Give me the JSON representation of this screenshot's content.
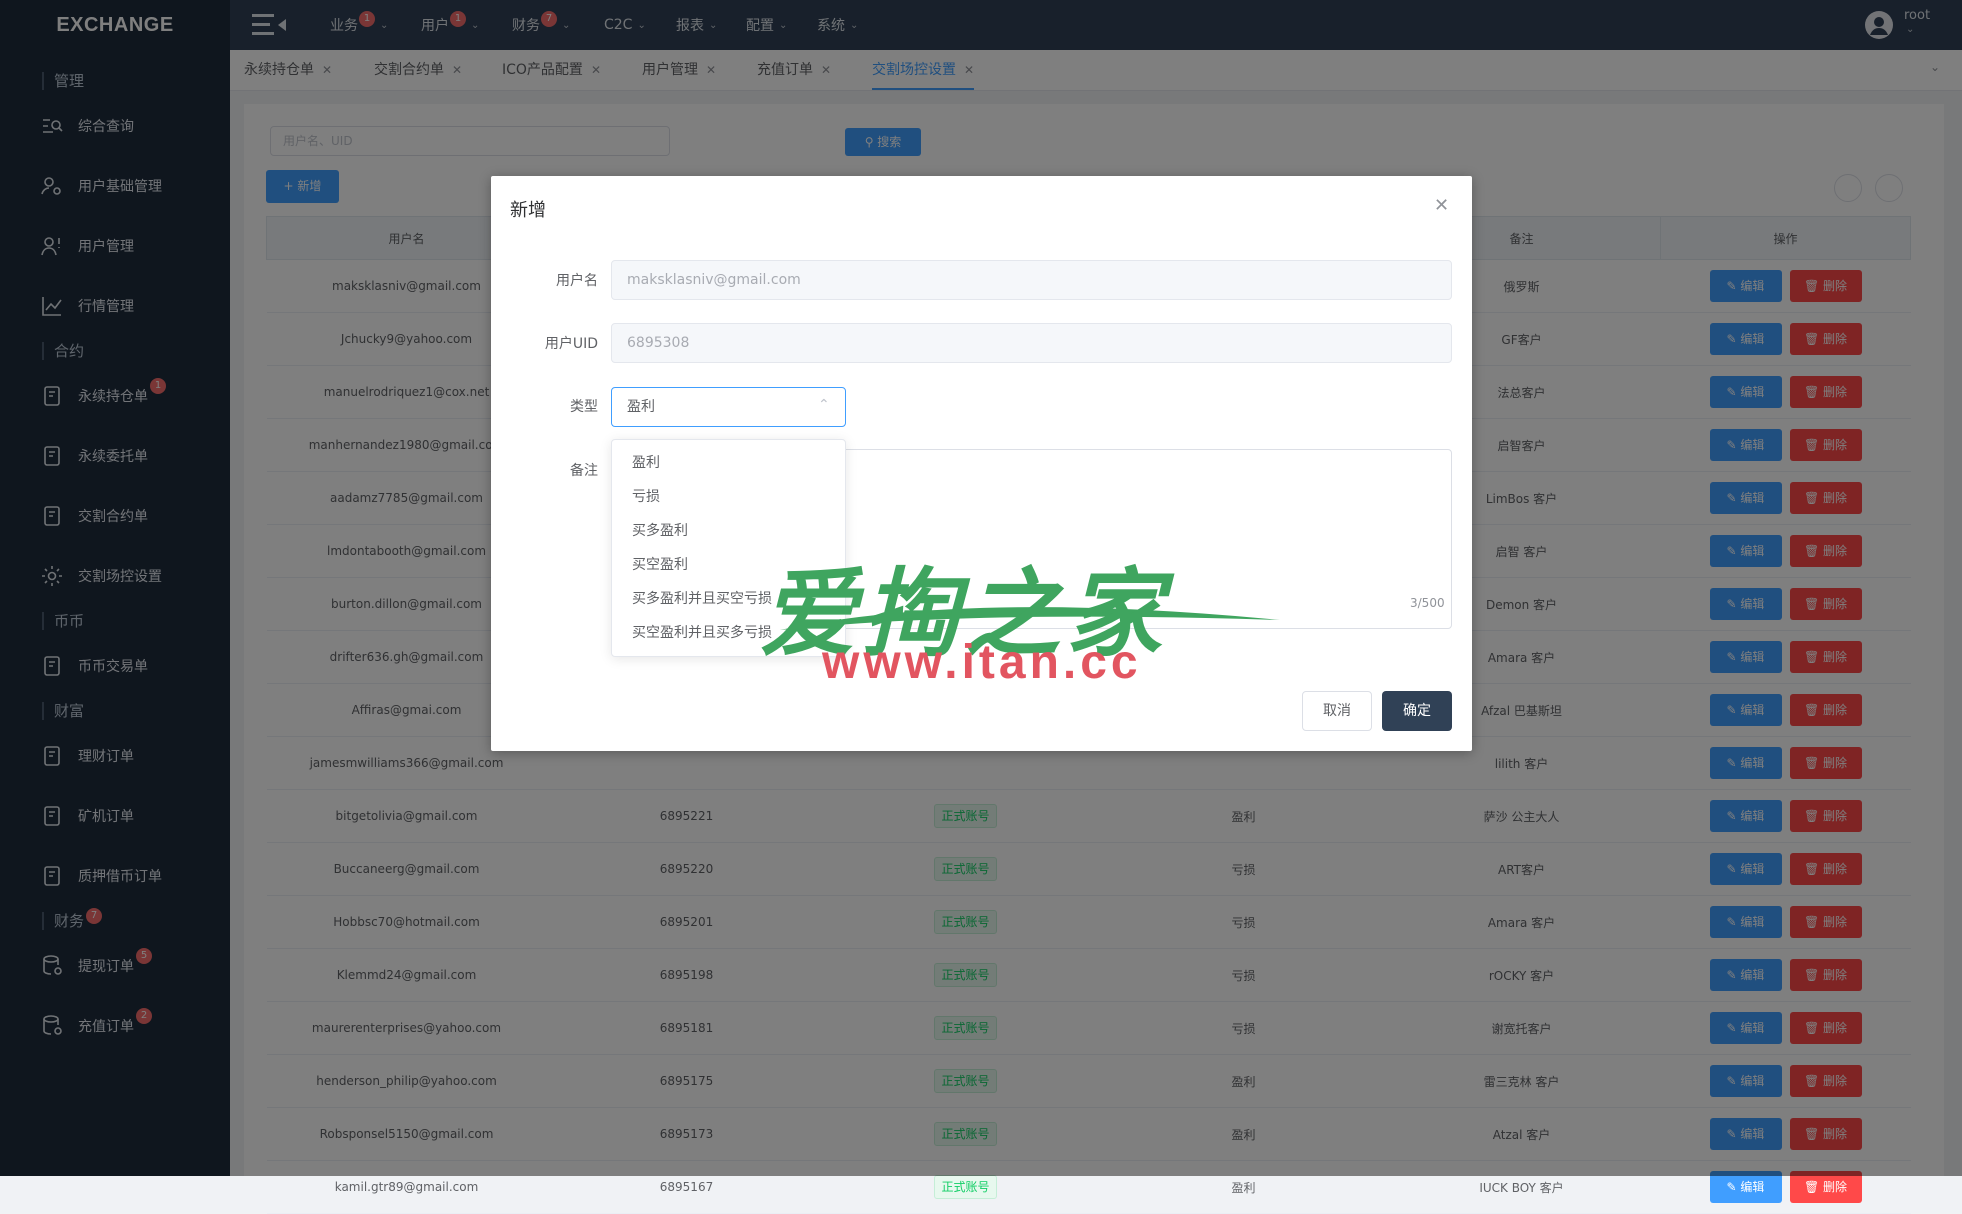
{
  "app": {
    "logo": "EXCHANGE"
  },
  "sidebar": {
    "sections": [
      "管理",
      "合约",
      "币币",
      "财富",
      "财务"
    ],
    "finance_badge": "7",
    "items": [
      {
        "label": "综合查询",
        "icon": "search-list-icon"
      },
      {
        "label": "用户基础管理",
        "icon": "user-gear-icon"
      },
      {
        "label": "用户管理",
        "icon": "user-alert-icon"
      },
      {
        "label": "行情管理",
        "icon": "chart-line-icon"
      },
      {
        "label": "永续持仓单",
        "icon": "document-icon",
        "badge": "1"
      },
      {
        "label": "永续委托单",
        "icon": "document-icon"
      },
      {
        "label": "交割合约单",
        "icon": "document-icon"
      },
      {
        "label": "交割场控设置",
        "icon": "gear-icon"
      },
      {
        "label": "币币交易单",
        "icon": "document-icon"
      },
      {
        "label": "理财订单",
        "icon": "document-icon"
      },
      {
        "label": "矿机订单",
        "icon": "document-icon"
      },
      {
        "label": "质押借币订单",
        "icon": "document-icon"
      },
      {
        "label": "提现订单",
        "icon": "database-icon",
        "badge": "5"
      },
      {
        "label": "充值订单",
        "icon": "database-icon",
        "badge": "2"
      }
    ]
  },
  "topnav": {
    "items": [
      {
        "label": "业务",
        "badge": "1"
      },
      {
        "label": "用户",
        "badge": "1"
      },
      {
        "label": "财务",
        "badge": "7"
      },
      {
        "label": "C2C"
      },
      {
        "label": "报表"
      },
      {
        "label": "配置"
      },
      {
        "label": "系统"
      }
    ],
    "user": "root"
  },
  "tabs": [
    {
      "label": "永续持仓单",
      "active": false
    },
    {
      "label": "交割合约单",
      "active": false
    },
    {
      "label": "ICO产品配置",
      "active": false
    },
    {
      "label": "用户管理",
      "active": false
    },
    {
      "label": "充值订单",
      "active": false
    },
    {
      "label": "交割场控设置",
      "active": true
    }
  ],
  "toolbar": {
    "search_placeholder": "用户名、UID",
    "search_button": "搜索",
    "new_button": "新增"
  },
  "table": {
    "headers": [
      "用户名",
      "",
      "",
      "",
      "备注",
      "操作"
    ],
    "edit_label": "编辑",
    "delete_label": "删除",
    "rows": [
      {
        "user": "maksklasniv@gmail.com",
        "uid": "",
        "status": "",
        "type": "",
        "remark": "俄罗斯"
      },
      {
        "user": "Jchucky9@yahoo.com",
        "uid": "",
        "status": "",
        "type": "",
        "remark": "GF客户"
      },
      {
        "user": "manuelrodriquez1@cox.net",
        "uid": "",
        "status": "",
        "type": "",
        "remark": "法总客户"
      },
      {
        "user": "manhernandez1980@gmail.com",
        "uid": "",
        "status": "",
        "type": "",
        "remark": "启智客户"
      },
      {
        "user": "aadamz7785@gmail.com",
        "uid": "",
        "status": "",
        "type": "",
        "remark": "LimBos 客户"
      },
      {
        "user": "lmdontabooth@gmail.com",
        "uid": "",
        "status": "",
        "type": "",
        "remark": "启智 客户"
      },
      {
        "user": "burton.dillon@gmail.com",
        "uid": "",
        "status": "",
        "type": "",
        "remark": "Demon 客户"
      },
      {
        "user": "drifter636.gh@gmail.com",
        "uid": "",
        "status": "",
        "type": "",
        "remark": "Amara 客户"
      },
      {
        "user": "Affiras@gmai.com",
        "uid": "",
        "status": "",
        "type": "",
        "remark": "Afzal 巴基斯坦"
      },
      {
        "user": "jamesmwilliams366@gmail.com",
        "uid": "",
        "status": "",
        "type": "",
        "remark": "lilith 客户"
      },
      {
        "user": "bitgetolivia@gmail.com",
        "uid": "6895221",
        "status": "正式账号",
        "type": "盈利",
        "remark": "萨沙 公主大人"
      },
      {
        "user": "Buccaneerg@gmail.com",
        "uid": "6895220",
        "status": "正式账号",
        "type": "亏损",
        "remark": "ART客户"
      },
      {
        "user": "Hobbsc70@hotmail.com",
        "uid": "6895201",
        "status": "正式账号",
        "type": "亏损",
        "remark": "Amara 客户"
      },
      {
        "user": "Klemmd24@gmail.com",
        "uid": "6895198",
        "status": "正式账号",
        "type": "亏损",
        "remark": "rOCKY 客户"
      },
      {
        "user": "maurerenterprises@yahoo.com",
        "uid": "6895181",
        "status": "正式账号",
        "type": "亏损",
        "remark": "谢宽托客户"
      },
      {
        "user": "henderson_philip@yahoo.com",
        "uid": "6895175",
        "status": "正式账号",
        "type": "盈利",
        "remark": "雷三克林 客户"
      },
      {
        "user": "Robsponsel5150@gmail.com",
        "uid": "6895173",
        "status": "正式账号",
        "type": "盈利",
        "remark": "Atzal 客户"
      },
      {
        "user": "kamil.gtr89@gmail.com",
        "uid": "6895167",
        "status": "正式账号",
        "type": "盈利",
        "remark": "IUCK BOY 客户"
      }
    ]
  },
  "dialog": {
    "title": "新增",
    "username_label": "用户名",
    "username_value": "maksklasniv@gmail.com",
    "uid_label": "用户UID",
    "uid_value": "6895308",
    "type_label": "类型",
    "type_value": "盈利",
    "remark_label": "备注",
    "counter": "3/500",
    "cancel": "取消",
    "confirm": "确定",
    "type_options": [
      "盈利",
      "亏损",
      "买多盈利",
      "买空盈利",
      "买多盈利并且买空亏损",
      "买空盈利并且买多亏损"
    ]
  },
  "watermark": {
    "title": "爱掏之家",
    "url": "www.itan.cc"
  },
  "colors": {
    "primary": "#409eff",
    "sidebar": "#1f2d3d",
    "topbar": "#304156",
    "danger": "#ff4949",
    "success": "#13ce66",
    "watermark_green": "#3fa55f",
    "watermark_red": "#e25560"
  }
}
